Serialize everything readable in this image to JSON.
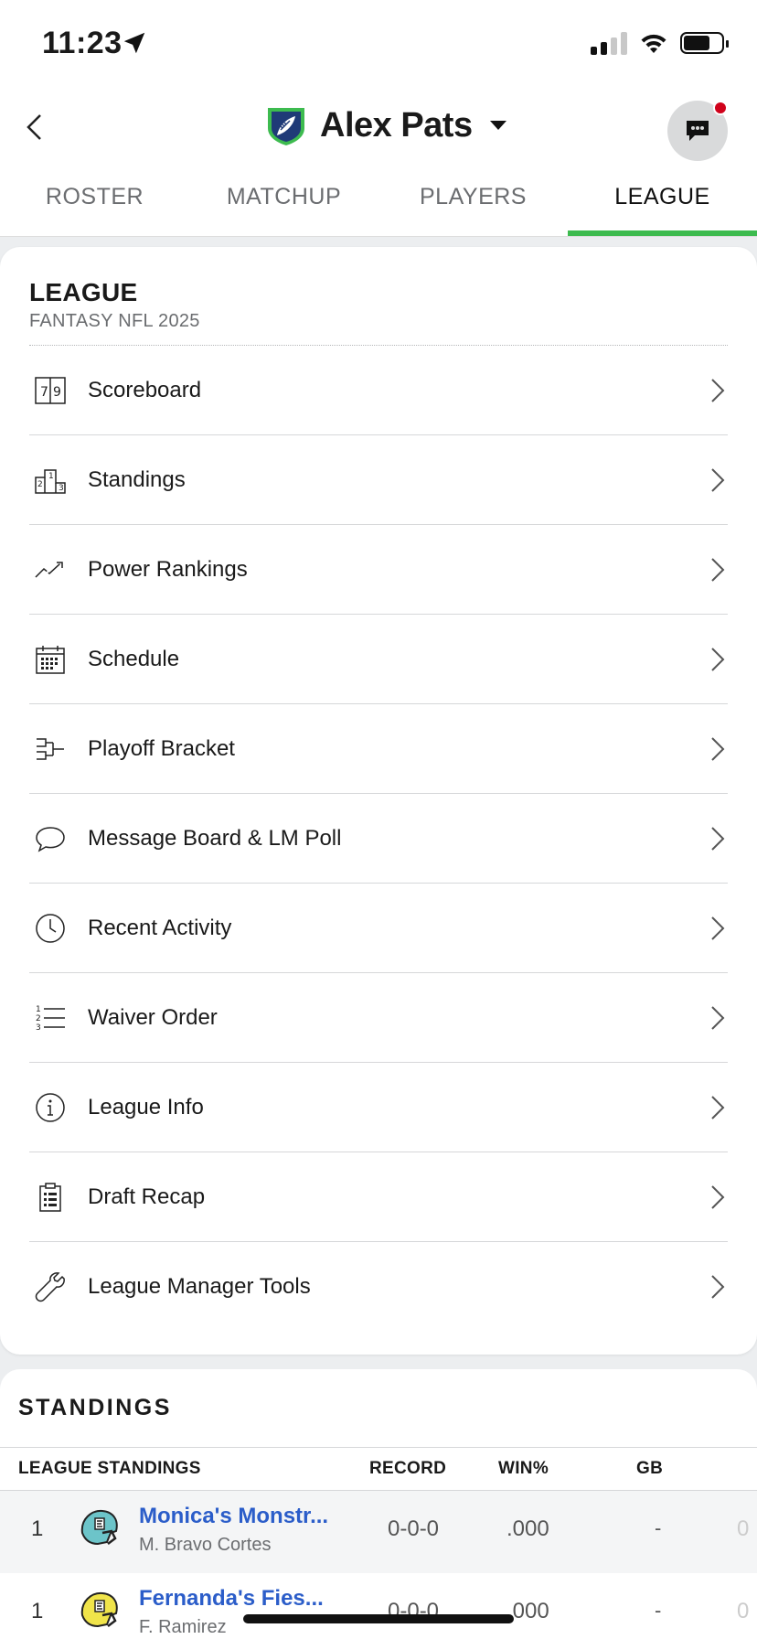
{
  "status": {
    "time": "11:23"
  },
  "header": {
    "team_name": "Alex Pats",
    "tabs": [
      {
        "label": "ROSTER"
      },
      {
        "label": "MATCHUP"
      },
      {
        "label": "PLAYERS"
      },
      {
        "label": "LEAGUE"
      }
    ],
    "active_tab": "LEAGUE",
    "accent_color": "#3dbb4f",
    "notification_color": "#d0021b"
  },
  "league": {
    "title": "LEAGUE",
    "subtitle": "FANTASY NFL 2025",
    "items": [
      {
        "label": "Scoreboard",
        "icon": "scoreboard-icon"
      },
      {
        "label": "Standings",
        "icon": "podium-icon"
      },
      {
        "label": "Power Rankings",
        "icon": "trend-icon"
      },
      {
        "label": "Schedule",
        "icon": "calendar-icon"
      },
      {
        "label": "Playoff Bracket",
        "icon": "bracket-icon"
      },
      {
        "label": "Message Board & LM Poll",
        "icon": "speech-bubble-icon"
      },
      {
        "label": "Recent Activity",
        "icon": "clock-icon"
      },
      {
        "label": "Waiver Order",
        "icon": "numbered-list-icon"
      },
      {
        "label": "League Info",
        "icon": "info-icon"
      },
      {
        "label": "Draft Recap",
        "icon": "clipboard-icon"
      },
      {
        "label": "League Manager Tools",
        "icon": "wrench-icon"
      }
    ]
  },
  "standings": {
    "title": "STANDINGS",
    "columns": {
      "team": "LEAGUE STANDINGS",
      "record": "RECORD",
      "win_pct": "WIN%",
      "gb": "GB"
    },
    "rows": [
      {
        "rank": "1",
        "team": "Monica's Monstr...",
        "owner": "M. Bravo Cortes",
        "record": "0-0-0",
        "win_pct": ".000",
        "gb": "-",
        "extra": "0",
        "helmet_color": "#6cc4c9"
      },
      {
        "rank": "1",
        "team": "Fernanda's Fies...",
        "owner": "F. Ramirez",
        "record": "0-0-0",
        "win_pct": ".000",
        "gb": "-",
        "extra": "0",
        "helmet_color": "#f0e44a"
      }
    ],
    "link_color": "#2b5dc9"
  }
}
